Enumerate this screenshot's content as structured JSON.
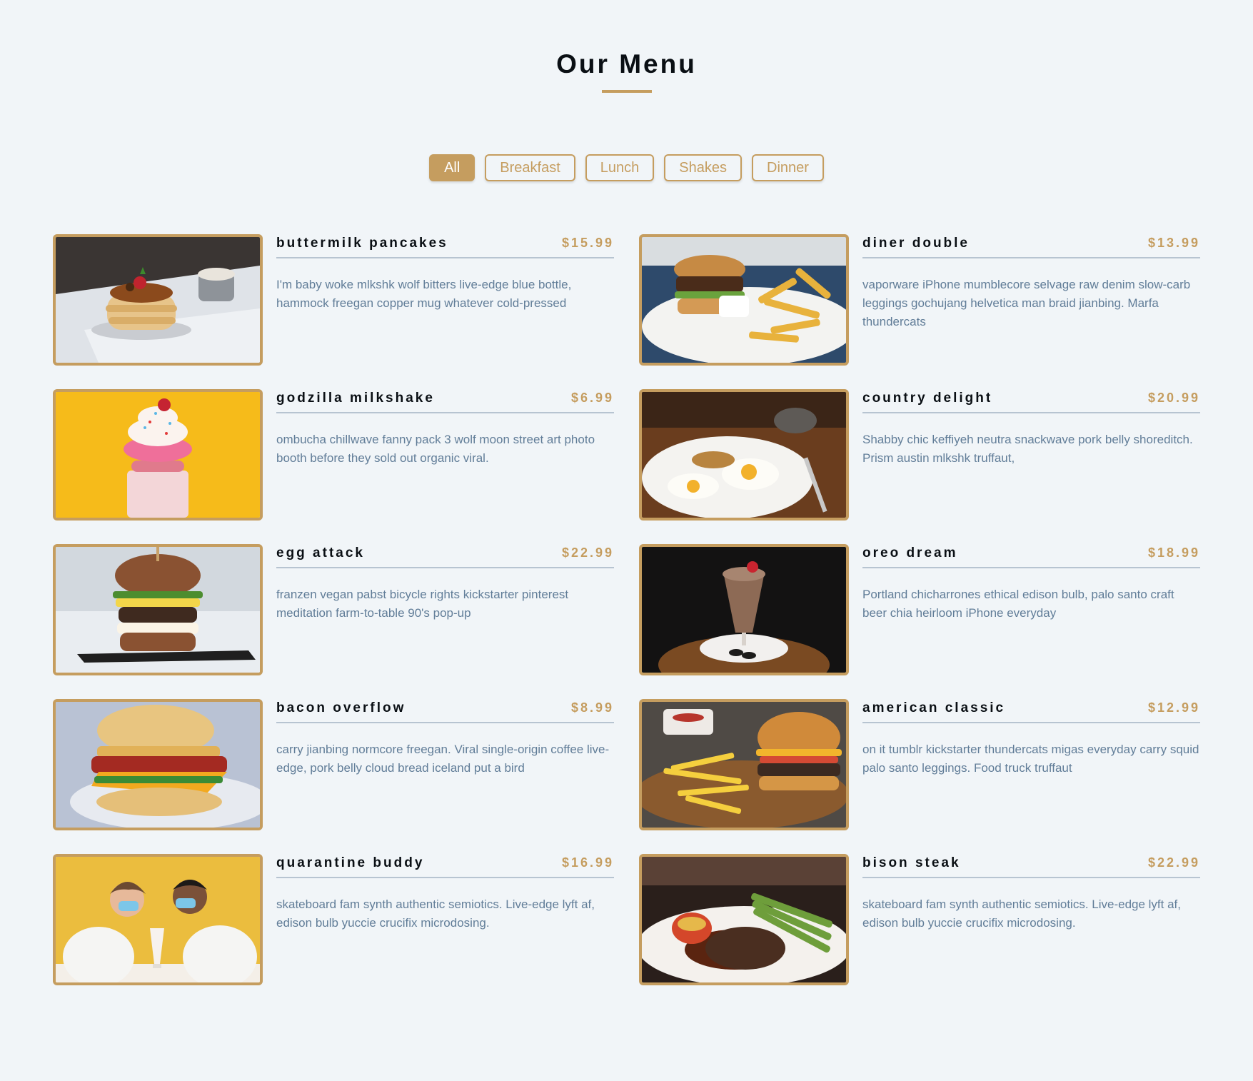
{
  "header": {
    "title": "Our Menu"
  },
  "filters": [
    {
      "label": "All",
      "active": true
    },
    {
      "label": "Breakfast",
      "active": false
    },
    {
      "label": "Lunch",
      "active": false
    },
    {
      "label": "Shakes",
      "active": false
    },
    {
      "label": "Dinner",
      "active": false
    }
  ],
  "colors": {
    "accent": "#c59d5f",
    "background": "#f1f5f8",
    "text_muted": "#617d98"
  },
  "menu": [
    {
      "name": "buttermilk pancakes",
      "price": "$15.99",
      "desc": "I'm baby woke mlkshk wolf bitters live-edge blue bottle, hammock freegan copper mug whatever cold-pressed"
    },
    {
      "name": "diner double",
      "price": "$13.99",
      "desc": "vaporware iPhone mumblecore selvage raw denim slow-carb leggings gochujang helvetica man braid jianbing. Marfa thundercats"
    },
    {
      "name": "godzilla milkshake",
      "price": "$6.99",
      "desc": "ombucha chillwave fanny pack 3 wolf moon street art photo booth before they sold out organic viral."
    },
    {
      "name": "country delight",
      "price": "$20.99",
      "desc": "Shabby chic keffiyeh neutra snackwave pork belly shoreditch. Prism austin mlkshk truffaut,"
    },
    {
      "name": "egg attack",
      "price": "$22.99",
      "desc": "franzen vegan pabst bicycle rights kickstarter pinterest meditation farm-to-table 90's pop-up"
    },
    {
      "name": "oreo dream",
      "price": "$18.99",
      "desc": "Portland chicharrones ethical edison bulb, palo santo craft beer chia heirloom iPhone everyday"
    },
    {
      "name": "bacon overflow",
      "price": "$8.99",
      "desc": "carry jianbing normcore freegan. Viral single-origin coffee live-edge, pork belly cloud bread iceland put a bird"
    },
    {
      "name": "american classic",
      "price": "$12.99",
      "desc": "on it tumblr kickstarter thundercats migas everyday carry squid palo santo leggings. Food truck truffaut"
    },
    {
      "name": "quarantine buddy",
      "price": "$16.99",
      "desc": "skateboard fam synth authentic semiotics. Live-edge lyft af, edison bulb yuccie crucifix microdosing."
    },
    {
      "name": "bison steak",
      "price": "$22.99",
      "desc": "skateboard fam synth authentic semiotics. Live-edge lyft af, edison bulb yuccie crucifix microdosing."
    }
  ]
}
